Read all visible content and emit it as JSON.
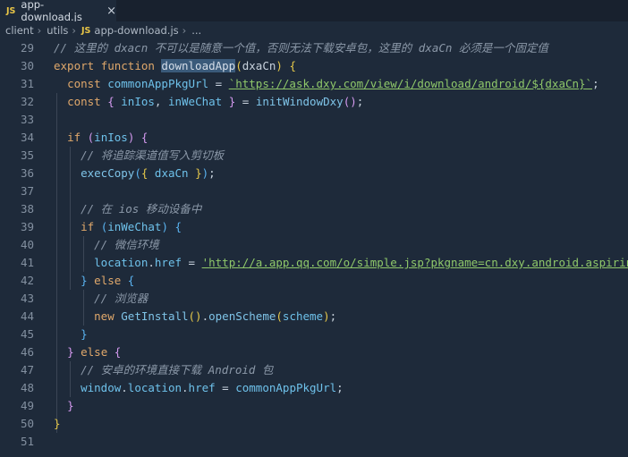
{
  "tab": {
    "badge": "JS",
    "title": "app-download.js",
    "close": "×"
  },
  "breadcrumb": [
    "client",
    "utils",
    "app-download.js",
    "..."
  ],
  "breadcrumb_sep": "›",
  "lines": [
    {
      "num": "29",
      "tokens": [
        [
          "c",
          "// 这里的 dxacn 不可以是随意一个值，否则无法下载安卓包，这里的 dxaCn 必须是一个固定值"
        ]
      ]
    },
    {
      "num": "30",
      "tokens": [
        [
          "k",
          "export "
        ],
        [
          "k",
          "function "
        ],
        [
          "h",
          "downloadApp"
        ],
        [
          "b",
          "("
        ],
        [
          "p",
          "dxaCn"
        ],
        [
          "b",
          ")"
        ],
        [
          "p",
          " "
        ],
        [
          "b",
          "{"
        ]
      ]
    },
    {
      "num": "31",
      "tokens": [
        [
          "p",
          "  "
        ],
        [
          "k",
          "const "
        ],
        [
          "v",
          "commonAppPkgUrl"
        ],
        [
          "p",
          " = "
        ],
        [
          "s",
          "`https://ask.dxy.com/view/i/download/android/${dxaCn}`"
        ],
        [
          "p",
          ";"
        ]
      ]
    },
    {
      "num": "32",
      "tokens": [
        [
          "p",
          "  "
        ],
        [
          "k",
          "const "
        ],
        [
          "b2",
          "{ "
        ],
        [
          "v",
          "inIos"
        ],
        [
          "p",
          ", "
        ],
        [
          "v",
          "inWeChat"
        ],
        [
          "b2",
          " }"
        ],
        [
          "p",
          " = "
        ],
        [
          "f",
          "initWindowDxy"
        ],
        [
          "b2",
          "()"
        ],
        [
          "p",
          ";"
        ]
      ]
    },
    {
      "num": "33",
      "tokens": []
    },
    {
      "num": "34",
      "tokens": [
        [
          "p",
          "  "
        ],
        [
          "k",
          "if "
        ],
        [
          "b2",
          "("
        ],
        [
          "v",
          "inIos"
        ],
        [
          "b2",
          ")"
        ],
        [
          "p",
          " "
        ],
        [
          "b2",
          "{"
        ]
      ]
    },
    {
      "num": "35",
      "tokens": [
        [
          "p",
          "    "
        ],
        [
          "c",
          "// 将追踪渠道值写入剪切板"
        ]
      ]
    },
    {
      "num": "36",
      "tokens": [
        [
          "p",
          "    "
        ],
        [
          "f",
          "execCopy"
        ],
        [
          "b3",
          "("
        ],
        [
          "b",
          "{ "
        ],
        [
          "v",
          "dxaCn"
        ],
        [
          "b",
          " }"
        ],
        [
          "b3",
          ")"
        ],
        [
          "p",
          ";"
        ]
      ]
    },
    {
      "num": "37",
      "tokens": []
    },
    {
      "num": "38",
      "tokens": [
        [
          "p",
          "    "
        ],
        [
          "c",
          "// 在 ios 移动设备中"
        ]
      ]
    },
    {
      "num": "39",
      "tokens": [
        [
          "p",
          "    "
        ],
        [
          "k",
          "if "
        ],
        [
          "b3",
          "("
        ],
        [
          "v",
          "inWeChat"
        ],
        [
          "b3",
          ")"
        ],
        [
          "p",
          " "
        ],
        [
          "b3",
          "{"
        ]
      ]
    },
    {
      "num": "40",
      "tokens": [
        [
          "p",
          "      "
        ],
        [
          "c",
          "// 微信环境"
        ]
      ]
    },
    {
      "num": "41",
      "tokens": [
        [
          "p",
          "      "
        ],
        [
          "v",
          "location"
        ],
        [
          "p",
          "."
        ],
        [
          "v",
          "href"
        ],
        [
          "p",
          " = "
        ],
        [
          "s",
          "'http://a.app.qq.com/o/simple.jsp?pkgname=cn.dxy.android.aspirin'"
        ],
        [
          "p",
          ";"
        ]
      ]
    },
    {
      "num": "42",
      "tokens": [
        [
          "p",
          "    "
        ],
        [
          "b3",
          "}"
        ],
        [
          "k",
          " else "
        ],
        [
          "b3",
          "{"
        ]
      ]
    },
    {
      "num": "43",
      "tokens": [
        [
          "p",
          "      "
        ],
        [
          "c",
          "// 浏览器"
        ]
      ]
    },
    {
      "num": "44",
      "tokens": [
        [
          "p",
          "      "
        ],
        [
          "k",
          "new "
        ],
        [
          "f",
          "GetInstall"
        ],
        [
          "b",
          "()"
        ],
        [
          "p",
          "."
        ],
        [
          "f",
          "openScheme"
        ],
        [
          "b",
          "("
        ],
        [
          "v",
          "scheme"
        ],
        [
          "b",
          ")"
        ],
        [
          "p",
          ";"
        ]
      ]
    },
    {
      "num": "45",
      "tokens": [
        [
          "p",
          "    "
        ],
        [
          "b3",
          "}"
        ]
      ]
    },
    {
      "num": "46",
      "tokens": [
        [
          "p",
          "  "
        ],
        [
          "b2",
          "}"
        ],
        [
          "k",
          " else "
        ],
        [
          "b2",
          "{"
        ]
      ]
    },
    {
      "num": "47",
      "tokens": [
        [
          "p",
          "    "
        ],
        [
          "c",
          "// 安卓的环境直接下载 Android 包"
        ]
      ]
    },
    {
      "num": "48",
      "tokens": [
        [
          "p",
          "    "
        ],
        [
          "v",
          "window"
        ],
        [
          "p",
          "."
        ],
        [
          "v",
          "location"
        ],
        [
          "p",
          "."
        ],
        [
          "v",
          "href"
        ],
        [
          "p",
          " = "
        ],
        [
          "v",
          "commonAppPkgUrl"
        ],
        [
          "p",
          ";"
        ]
      ]
    },
    {
      "num": "49",
      "tokens": [
        [
          "p",
          "  "
        ],
        [
          "b2",
          "}"
        ]
      ]
    },
    {
      "num": "50",
      "tokens": [
        [
          "b",
          "}"
        ]
      ]
    },
    {
      "num": "51",
      "tokens": []
    }
  ]
}
